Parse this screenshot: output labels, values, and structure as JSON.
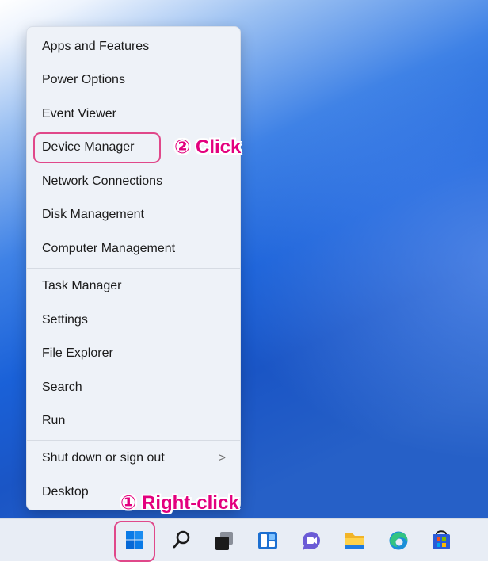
{
  "context_menu": {
    "items": [
      {
        "label": "Apps and Features"
      },
      {
        "label": "Power Options"
      },
      {
        "label": "Event Viewer"
      },
      {
        "label": "Device Manager"
      },
      {
        "label": "Network Connections"
      },
      {
        "label": "Disk Management"
      },
      {
        "label": "Computer Management"
      },
      {
        "label": "Task Manager"
      },
      {
        "label": "Settings"
      },
      {
        "label": "File Explorer"
      },
      {
        "label": "Search"
      },
      {
        "label": "Run"
      },
      {
        "label": "Shut down or sign out",
        "submenu_glyph": ">"
      },
      {
        "label": "Desktop"
      }
    ]
  },
  "annotations": {
    "step1": "① Right-click",
    "step2": "② Click",
    "highlight_color": "#e3007e"
  },
  "taskbar": {
    "icons": [
      "start-icon",
      "search-icon",
      "task-view-icon",
      "widgets-icon",
      "chat-icon",
      "file-explorer-icon",
      "edge-icon",
      "store-icon"
    ]
  },
  "colors": {
    "accent_blue": "#0067c0",
    "wallpaper_blue": "#1a61d8"
  }
}
